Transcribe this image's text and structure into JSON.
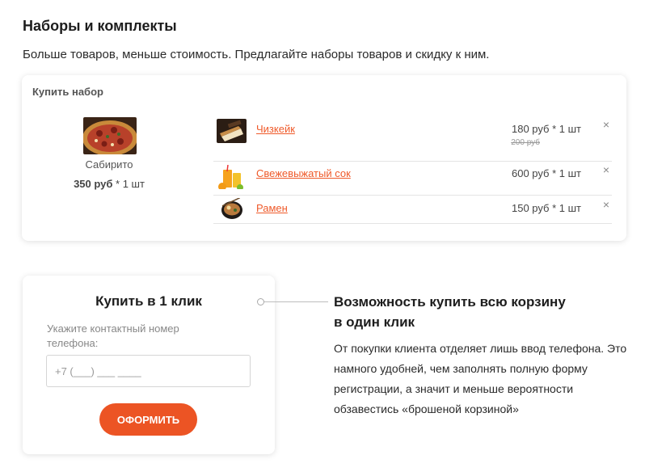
{
  "header": {
    "title": "Наборы и комплекты",
    "subtitle": "Больше товаров, меньше стоимость. Предлагайте наборы товаров и скидку к ним."
  },
  "set_card": {
    "title": "Купить набор",
    "main_item": {
      "name": "Сабирито",
      "price": "350 руб",
      "qty": " * 1 шт",
      "image_icon": "pizza-image"
    },
    "items": [
      {
        "name": "Чизкейк",
        "price": "180 руб * 1 шт",
        "old_price": "200 руб",
        "image_icon": "cheesecake-image"
      },
      {
        "name": "Свежевыжатый сок",
        "price": "600 руб * 1 шт",
        "image_icon": "juice-image"
      },
      {
        "name": "Рамен",
        "price": "150 руб * 1 шт",
        "image_icon": "ramen-image"
      }
    ],
    "remove_symbol": "×"
  },
  "oneclick": {
    "title": "Купить в 1 клик",
    "label": "Укажите контактный номер телефона:",
    "phone_placeholder": "+7 (___) ___ ____",
    "button_label": "ОФОРМИТЬ"
  },
  "feature": {
    "title_line1": "Возможность купить всю корзину",
    "title_line2": "в  один клик",
    "text": "От покупки клиента отделяет лишь ввод телефона. Это намного удобней, чем заполнять полную форму регистрации, а значит и  меньше вероятности обзавестись «брошеной корзиной»"
  },
  "colors": {
    "accent": "#ec5424",
    "link": "#ef5a2a"
  }
}
